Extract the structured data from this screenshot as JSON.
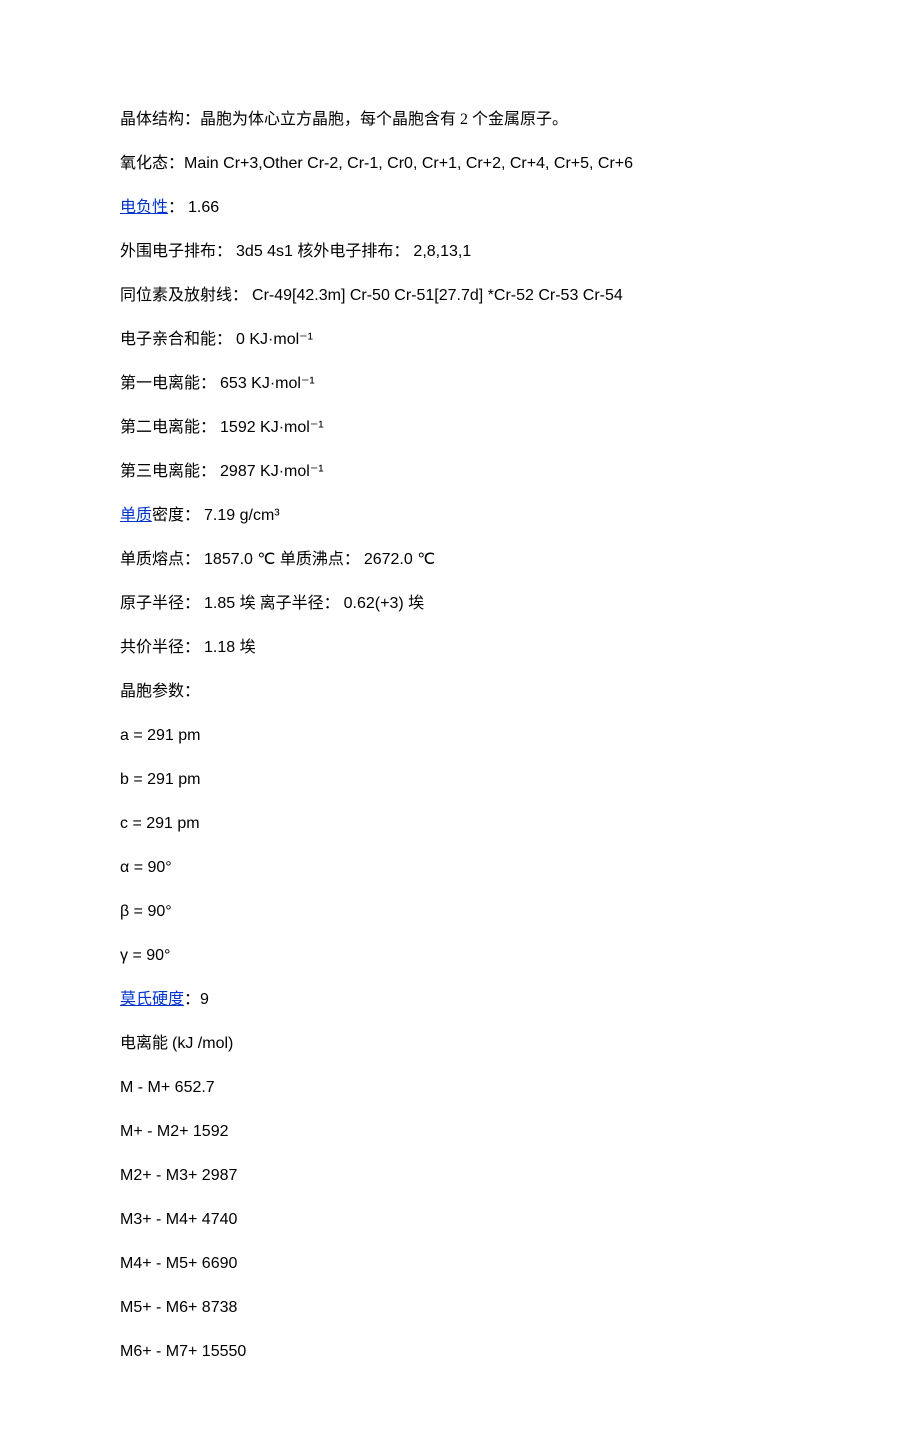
{
  "lines": [
    {
      "parts": [
        {
          "text": "晶体结构：晶胞为体心立方晶胞，每个晶胞含有 2 个金属原子。"
        }
      ]
    },
    {
      "parts": [
        {
          "text": "氧化态："
        },
        {
          "text": "Main Cr+3,Other Cr-2, Cr-1, Cr0, Cr+1, Cr+2, Cr+4, Cr+5, Cr+6",
          "cls": "arial"
        }
      ]
    },
    {
      "parts": [
        {
          "text": "电负性",
          "link": true
        },
        {
          "text": "：   "
        },
        {
          "text": "1.66",
          "cls": "arial"
        }
      ]
    },
    {
      "parts": [
        {
          "text": "外围电子排布：   "
        },
        {
          "text": "3d5 4s1 ",
          "cls": "arial"
        },
        {
          "text": "核外电子排布：   "
        },
        {
          "text": "2,8,13,1",
          "cls": "arial"
        }
      ]
    },
    {
      "parts": [
        {
          "text": "同位素及放射线：    "
        },
        {
          "text": "Cr-49[42.3m] Cr-50 Cr-51[27.7d] *Cr-52 Cr-53 Cr-54",
          "cls": "arial"
        }
      ]
    },
    {
      "parts": [
        {
          "text": "电子亲合和能：   "
        },
        {
          "text": "0 KJ·mol⁻¹",
          "cls": "arial"
        }
      ]
    },
    {
      "parts": [
        {
          "text": "第一电离能：   "
        },
        {
          "text": "653 KJ·mol⁻¹",
          "cls": "arial"
        }
      ]
    },
    {
      "parts": [
        {
          "text": "第二电离能：   "
        },
        {
          "text": "1592 KJ·mol⁻¹",
          "cls": "arial"
        }
      ]
    },
    {
      "parts": [
        {
          "text": "第三电离能：   "
        },
        {
          "text": "2987 KJ·mol⁻¹",
          "cls": "arial"
        }
      ]
    },
    {
      "parts": [
        {
          "text": "单质",
          "link": true
        },
        {
          "text": "密度：   "
        },
        {
          "text": "7.19 g/cm³",
          "cls": "arial"
        }
      ]
    },
    {
      "parts": [
        {
          "text": "单质熔点：   "
        },
        {
          "text": "1857.0 ℃  ",
          "cls": "arial"
        },
        {
          "text": "单质沸点：   "
        },
        {
          "text": "2672.0 ℃",
          "cls": "arial"
        }
      ]
    },
    {
      "parts": [
        {
          "text": "原子半径：   "
        },
        {
          "text": "1.85  ",
          "cls": "arial"
        },
        {
          "text": "埃  离子半径：   "
        },
        {
          "text": "0.62(+3)  ",
          "cls": "arial"
        },
        {
          "text": "埃"
        }
      ]
    },
    {
      "parts": [
        {
          "text": "共价半径：   "
        },
        {
          "text": "1.18  ",
          "cls": "arial"
        },
        {
          "text": "埃"
        }
      ]
    },
    {
      "parts": [
        {
          "text": "晶胞参数："
        }
      ]
    },
    {
      "parts": [
        {
          "text": "a = 291 pm",
          "cls": "arial"
        }
      ]
    },
    {
      "parts": [
        {
          "text": "b = 291 pm",
          "cls": "arial"
        }
      ]
    },
    {
      "parts": [
        {
          "text": "c = 291 pm",
          "cls": "arial"
        }
      ]
    },
    {
      "parts": [
        {
          "text": "α = 90°",
          "cls": "arial"
        }
      ]
    },
    {
      "parts": [
        {
          "text": "β = 90°",
          "cls": "arial"
        }
      ]
    },
    {
      "parts": [
        {
          "text": "γ = 90°",
          "cls": "arial"
        }
      ]
    },
    {
      "parts": [
        {
          "text": "莫氏硬度",
          "link": true
        },
        {
          "text": "："
        },
        {
          "text": "9",
          "cls": "arial"
        }
      ]
    },
    {
      "parts": [
        {
          "text": "电离能  "
        },
        {
          "text": "(kJ /mol)",
          "cls": "arial"
        }
      ]
    },
    {
      "parts": [
        {
          "text": "M - M+ 652.7",
          "cls": "arial"
        }
      ]
    },
    {
      "parts": [
        {
          "text": "M+ - M2+ 1592",
          "cls": "arial"
        }
      ]
    },
    {
      "parts": [
        {
          "text": "M2+ - M3+ 2987",
          "cls": "arial"
        }
      ]
    },
    {
      "parts": [
        {
          "text": "M3+ - M4+ 4740",
          "cls": "arial"
        }
      ]
    },
    {
      "parts": [
        {
          "text": "M4+ - M5+ 6690",
          "cls": "arial"
        }
      ]
    },
    {
      "parts": [
        {
          "text": "M5+ - M6+ 8738",
          "cls": "arial"
        }
      ]
    },
    {
      "parts": [
        {
          "text": "M6+ - M7+ 15550",
          "cls": "arial"
        }
      ]
    }
  ]
}
